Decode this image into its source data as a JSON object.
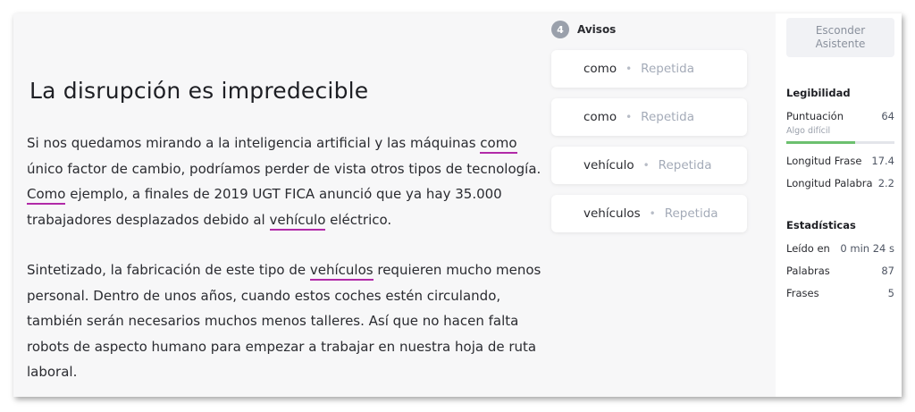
{
  "editor": {
    "title": "La disrupción es impredecible",
    "p1": {
      "s1": "Si nos quedamos mirando a la inteligencia artificial y las máquinas ",
      "h1": "como",
      "s2": " único factor de cambio, podríamos perder de vista otros tipos de tecnología. ",
      "h2": "Como",
      "s3": " ejemplo, a finales de 2019 UGT FICA anunció que ya hay 35.000 trabajadores desplazados debido al ",
      "h3": "vehículo",
      "s4": " eléctrico."
    },
    "p2": {
      "s1": "Sintetizado, la fabricación de este tipo de ",
      "h1": "vehículos",
      "s2": " requieren mucho menos personal. Dentro de unos años, cuando estos coches estén circulando, también serán necesarios muchos menos talleres. Así que no hacen falta robots de aspecto humano para empezar a trabajar en nuestra hoja de ruta laboral."
    },
    "highlight_color": "#b12aa8"
  },
  "warnings": {
    "count": "4",
    "title": "Avisos",
    "items": [
      {
        "word": "como",
        "type": "Repetida"
      },
      {
        "word": "como",
        "type": "Repetida"
      },
      {
        "word": "vehículo",
        "type": "Repetida"
      },
      {
        "word": "vehículos",
        "type": "Repetida"
      }
    ]
  },
  "sidebar": {
    "hide_button_line1": "Esconder",
    "hide_button_line2": "Asistente",
    "readability": {
      "title": "Legibilidad",
      "score_label": "Puntuación",
      "score_value": "64",
      "score_desc": "Algo difícil",
      "score_fraction": 0.64,
      "bar_color": "#6cc06f",
      "sentence_length_label": "Longitud Frase",
      "sentence_length_value": "17.4",
      "word_length_label": "Longitud Palabra",
      "word_length_value": "2.2"
    },
    "stats": {
      "title": "Estadísticas",
      "read_label": "Leído en",
      "read_value": "0 min 24 s",
      "words_label": "Palabras",
      "words_value": "87",
      "sentences_label": "Frases",
      "sentences_value": "5"
    }
  }
}
